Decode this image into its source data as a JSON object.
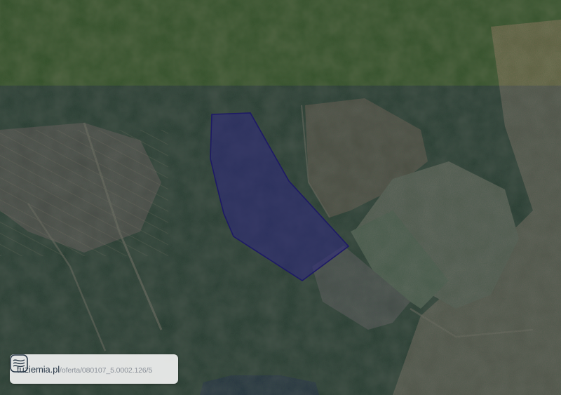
{
  "map": {
    "basemap": "satellite-imagery",
    "highlight": {
      "fill_color": "#2f2a7a",
      "stroke_color": "#1e1a66",
      "fill_opacity": 0.6
    },
    "overlay_tint_color": "#24306a"
  },
  "badge": {
    "logo_icon": "topographic-contour-icon",
    "site": "tuziemia.pl",
    "path": "/oferta/080107_5.0002.126/5"
  }
}
